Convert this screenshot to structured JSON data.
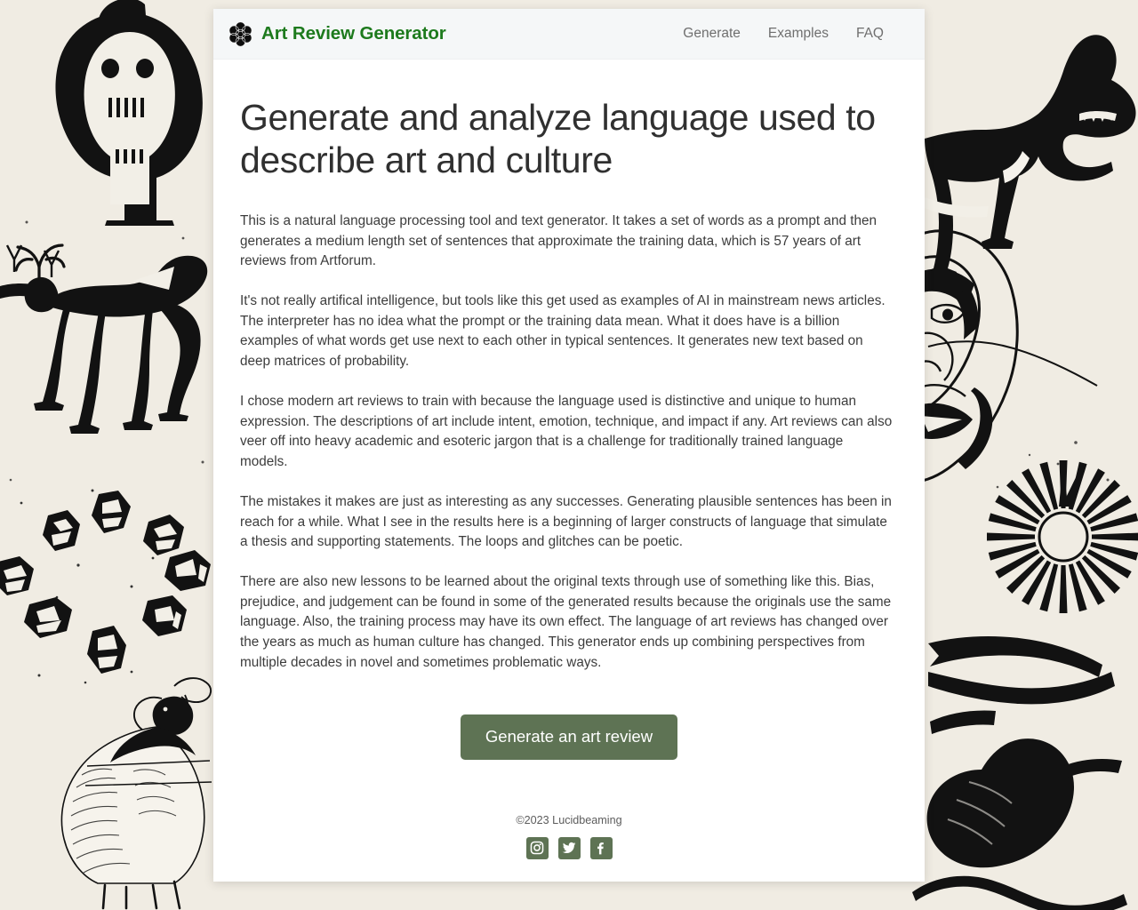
{
  "header": {
    "brand_title": "Art Review Generator",
    "logo_icon": "rosette-flower-icon",
    "nav": [
      {
        "label": "Generate"
      },
      {
        "label": "Examples"
      },
      {
        "label": "FAQ"
      }
    ]
  },
  "main": {
    "headline": "Generate and analyze language used to describe art and culture",
    "paragraphs": [
      "This is a natural language processing tool and text generator. It takes a set of words as a prompt and then generates a medium length set of sentences that approximate the training data, which is 57 years of art reviews from Artforum.",
      "It's not really artifical intelligence, but tools like this get used as examples of AI in mainstream news articles. The interpreter has no idea what the prompt or the training data mean. What it does have is a billion examples of what words get use next to each other in typical sentences. It generates new text based on deep matrices of probability.",
      "I chose modern art reviews to train with because the language used is distinctive and unique to human expression. The descriptions of art include intent, emotion, technique, and impact if any. Art reviews can also veer off into heavy academic and esoteric jargon that is a challenge for traditionally trained language models.",
      "The mistakes it makes are just as interesting as any successes. Generating plausible sentences has been in reach for a while. What I see in the results here is a beginning of larger constructs of language that simulate a thesis and supporting statements. The loops and glitches can be poetic.",
      "There are also new lessons to be learned about the original texts through use of something like this. Bias, prejudice, and judgement can be found in some of the generated results because the originals use the same language. Also, the training process may have its own effect. The language of art reviews has changed over the years as much as human culture has changed. This generator ends up combining perspectives from multiple decades in novel and sometimes problematic ways."
    ],
    "cta_label": "Generate an art review"
  },
  "footer": {
    "copyright": "©2023 Lucidbeaming",
    "social": [
      {
        "name": "instagram-icon"
      },
      {
        "name": "twitter-icon"
      },
      {
        "name": "facebook-icon"
      }
    ]
  },
  "colors": {
    "brand_green": "#1d7a1d",
    "accent_green": "#5e7354",
    "page_background": "#f0ece3",
    "card_background": "#ffffff",
    "header_background": "#f5f7f8",
    "nav_link": "#6f6f6f",
    "body_text": "#3c3c3c",
    "artwork_ink": "#111111"
  }
}
